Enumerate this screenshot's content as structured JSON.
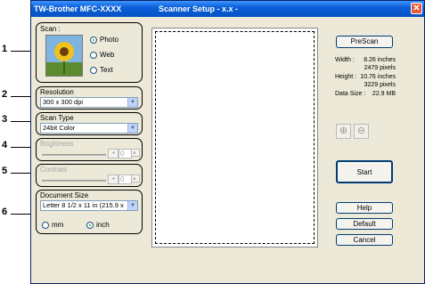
{
  "window": {
    "title_left": "TW-Brother MFC-XXXX",
    "title_center": "Scanner Setup - x.x -",
    "close": "✕"
  },
  "callouts": [
    "1",
    "2",
    "3",
    "4",
    "5",
    "6"
  ],
  "scan": {
    "label": "Scan :",
    "options": [
      {
        "label": "Photo",
        "selected": true
      },
      {
        "label": "Web",
        "selected": false
      },
      {
        "label": "Text",
        "selected": false
      }
    ]
  },
  "resolution": {
    "label": "Resolution",
    "value": "300 x 300 dpi"
  },
  "scan_type": {
    "label": "Scan Type",
    "value": "24bit Color"
  },
  "brightness": {
    "label": "Brightness",
    "value": "0"
  },
  "contrast": {
    "label": "Contrast",
    "value": "0"
  },
  "document_size": {
    "label": "Document Size",
    "value": "Letter 8 1/2 x 11 in (215.9 x",
    "units": [
      {
        "label": "mm",
        "selected": false
      },
      {
        "label": "inch",
        "selected": true
      }
    ]
  },
  "prescan_label": "PreScan",
  "info": {
    "width_label": "Width :",
    "width_in": "8.26 inches",
    "width_px": "2479 pixels",
    "height_label": "Height :",
    "height_in": "10.76 inches",
    "height_px": "3229 pixels",
    "size_label": "Data Size :",
    "size_value": "22.9 MB"
  },
  "buttons": {
    "start": "Start",
    "help": "Help",
    "default": "Default",
    "cancel": "Cancel"
  },
  "colors": {
    "titlebar": "#0a5fd8",
    "dialog": "#ece9d8"
  }
}
